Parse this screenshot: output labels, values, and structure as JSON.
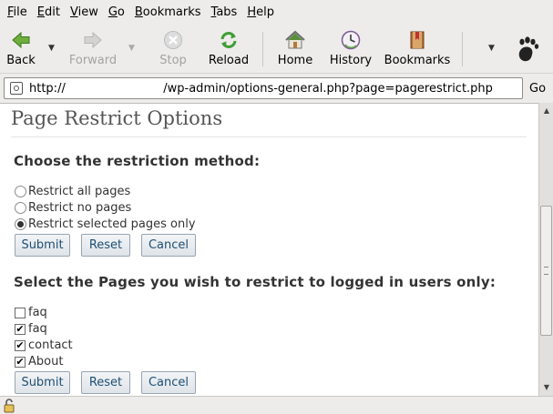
{
  "menubar": {
    "items": [
      {
        "label": "File",
        "u": "F",
        "rest": "ile"
      },
      {
        "label": "Edit",
        "u": "E",
        "rest": "dit"
      },
      {
        "label": "View",
        "u": "V",
        "rest": "iew"
      },
      {
        "label": "Go",
        "u": "G",
        "rest": "o"
      },
      {
        "label": "Bookmarks",
        "u": "B",
        "rest": "ookmarks"
      },
      {
        "label": "Tabs",
        "u": "T",
        "rest": "abs"
      },
      {
        "label": "Help",
        "u": "H",
        "rest": "elp"
      }
    ]
  },
  "toolbar": {
    "back_label": "Back",
    "forward_label": "Forward",
    "stop_label": "Stop",
    "reload_label": "Reload",
    "home_label": "Home",
    "history_label": "History",
    "bookmarks_label": "Bookmarks",
    "icons": {
      "back": "back-arrow-icon",
      "forward": "forward-arrow-icon",
      "stop": "stop-icon",
      "reload": "reload-icon",
      "home": "home-icon",
      "history": "history-icon",
      "bookmarks": "bookmarks-icon",
      "brand": "gnome-foot-icon"
    }
  },
  "urlbar": {
    "value": "http://                          /wp-admin/options-general.php?page=pagerestrict.php",
    "go_label": "Go"
  },
  "page": {
    "title": "Page Restrict Options",
    "method_heading": "Choose the restriction method:",
    "methods": [
      {
        "label": "Restrict all pages",
        "checked": false
      },
      {
        "label": "Restrict no pages",
        "checked": false
      },
      {
        "label": "Restrict selected pages only",
        "checked": true
      }
    ],
    "pages_heading": "Select the Pages you wish to restrict to logged in users only:",
    "pages": [
      {
        "label": "faq",
        "checked": false
      },
      {
        "label": "faq",
        "checked": true
      },
      {
        "label": "contact",
        "checked": true
      },
      {
        "label": "About",
        "checked": true
      }
    ],
    "submit_label": "Submit",
    "reset_label": "Reset",
    "cancel_label": "Cancel"
  },
  "colors": {
    "chrome_bg": "#edeceb",
    "page_bg": "#ffffff",
    "button_text": "#1d4f74",
    "reload_green": "#3f9e34"
  }
}
